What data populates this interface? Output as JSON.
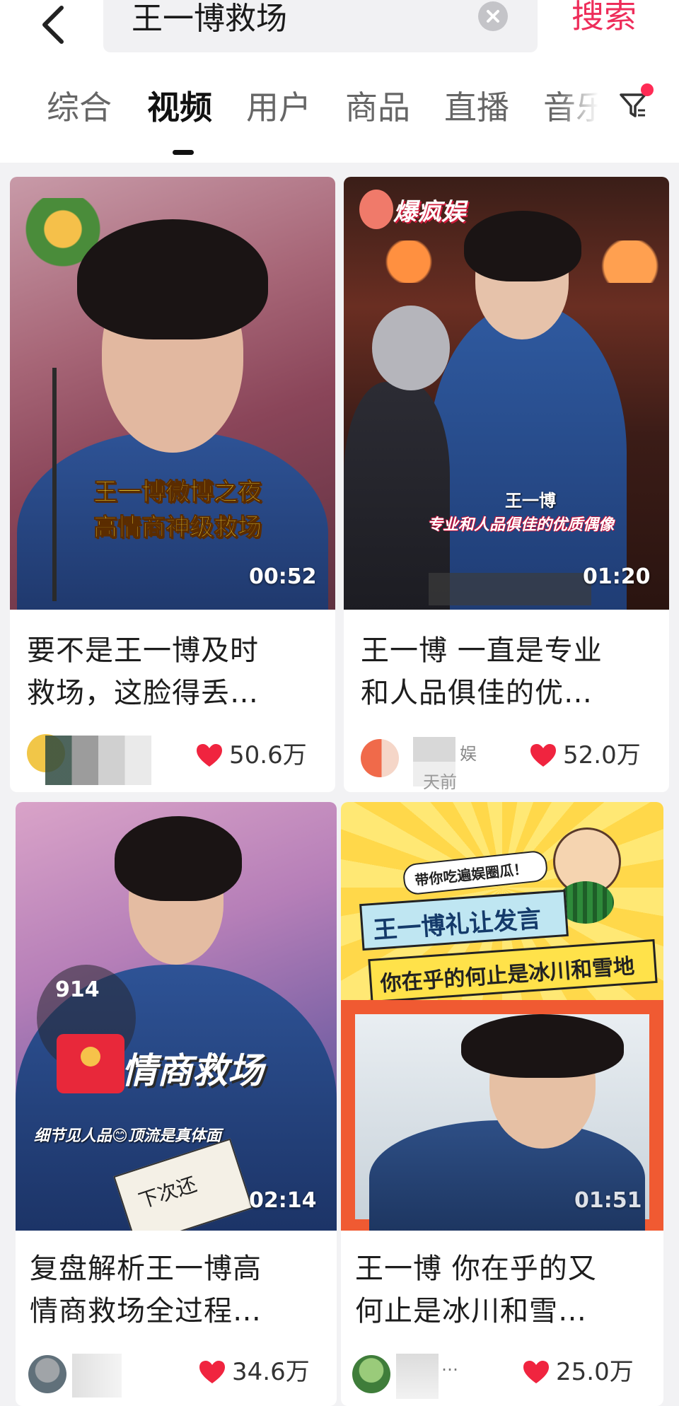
{
  "search": {
    "query": "王一博救场",
    "submit_label": "搜索"
  },
  "tabs": [
    {
      "label": "综合",
      "active": false
    },
    {
      "label": "视频",
      "active": true
    },
    {
      "label": "用户",
      "active": false
    },
    {
      "label": "商品",
      "active": false
    },
    {
      "label": "直播",
      "active": false
    },
    {
      "label": "音乐",
      "active": false
    }
  ],
  "colors": {
    "accent": "#ee2d5a",
    "heart": "#f0243f",
    "background": "#f2f2f4"
  },
  "cards": [
    {
      "duration": "00:52",
      "caption_line1": "王一博微博之夜",
      "caption_line2": "高情商神级救场",
      "title_line1": "要不是王一博及时",
      "title_line2": "救场，这脸得丢…",
      "likes": "50.6万"
    },
    {
      "duration": "01:20",
      "badge": "爆疯娱",
      "caption_name": "王一博",
      "caption_line": "专业和人品俱佳的优质偶像",
      "title_line1": "王一博 一直是专业",
      "title_line2": "和人品俱佳的优…",
      "author_fragment": "娱",
      "time_fragment": "天前",
      "likes": "52.0万"
    },
    {
      "duration": "02:14",
      "overlay_count": "914",
      "caption_big": "情商救场",
      "caption_small": "细节见人品😊顶流是真体面",
      "sign_text": "下次还",
      "title_line1": "复盘解析王一博高",
      "title_line2": "情商救场全过程…",
      "likes": "34.6万"
    },
    {
      "duration": "01:51",
      "banner_small": "带你吃遍娱圈瓜！",
      "banner_line1": "王一博礼让发言",
      "banner_line2": "你在乎的何止是冰川和雪地",
      "title_line1": "王一博 你在乎的又",
      "title_line2": "何止是冰川和雪…",
      "author_fragment": "…",
      "likes": "25.0万"
    }
  ]
}
